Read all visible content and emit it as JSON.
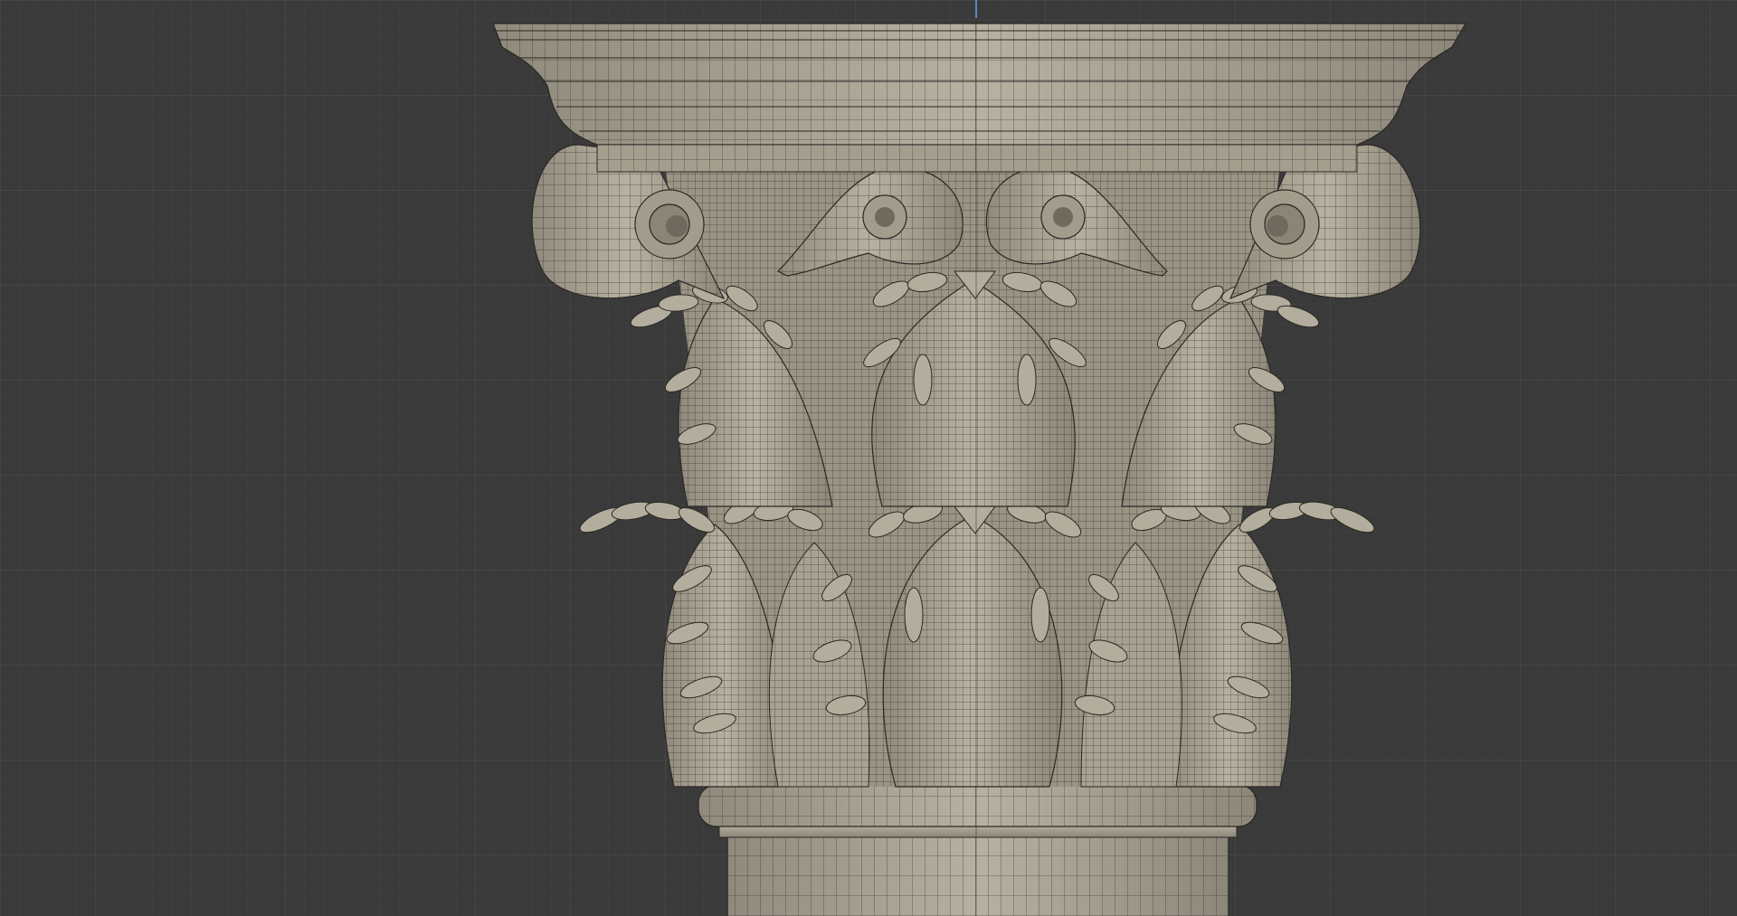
{
  "viewport": {
    "background": "#3a3a3a",
    "grid_minor_color": "#434343",
    "grid_major_color": "#4c4c4c",
    "z_axis_color": "#5b86c9",
    "mesh_color": "#a39d8d",
    "mesh_dark_color": "#6f6a5e",
    "wire_color": "#1f1e1b",
    "view_mode": "wireframe-over-solid",
    "object": "corinthian-capital"
  }
}
